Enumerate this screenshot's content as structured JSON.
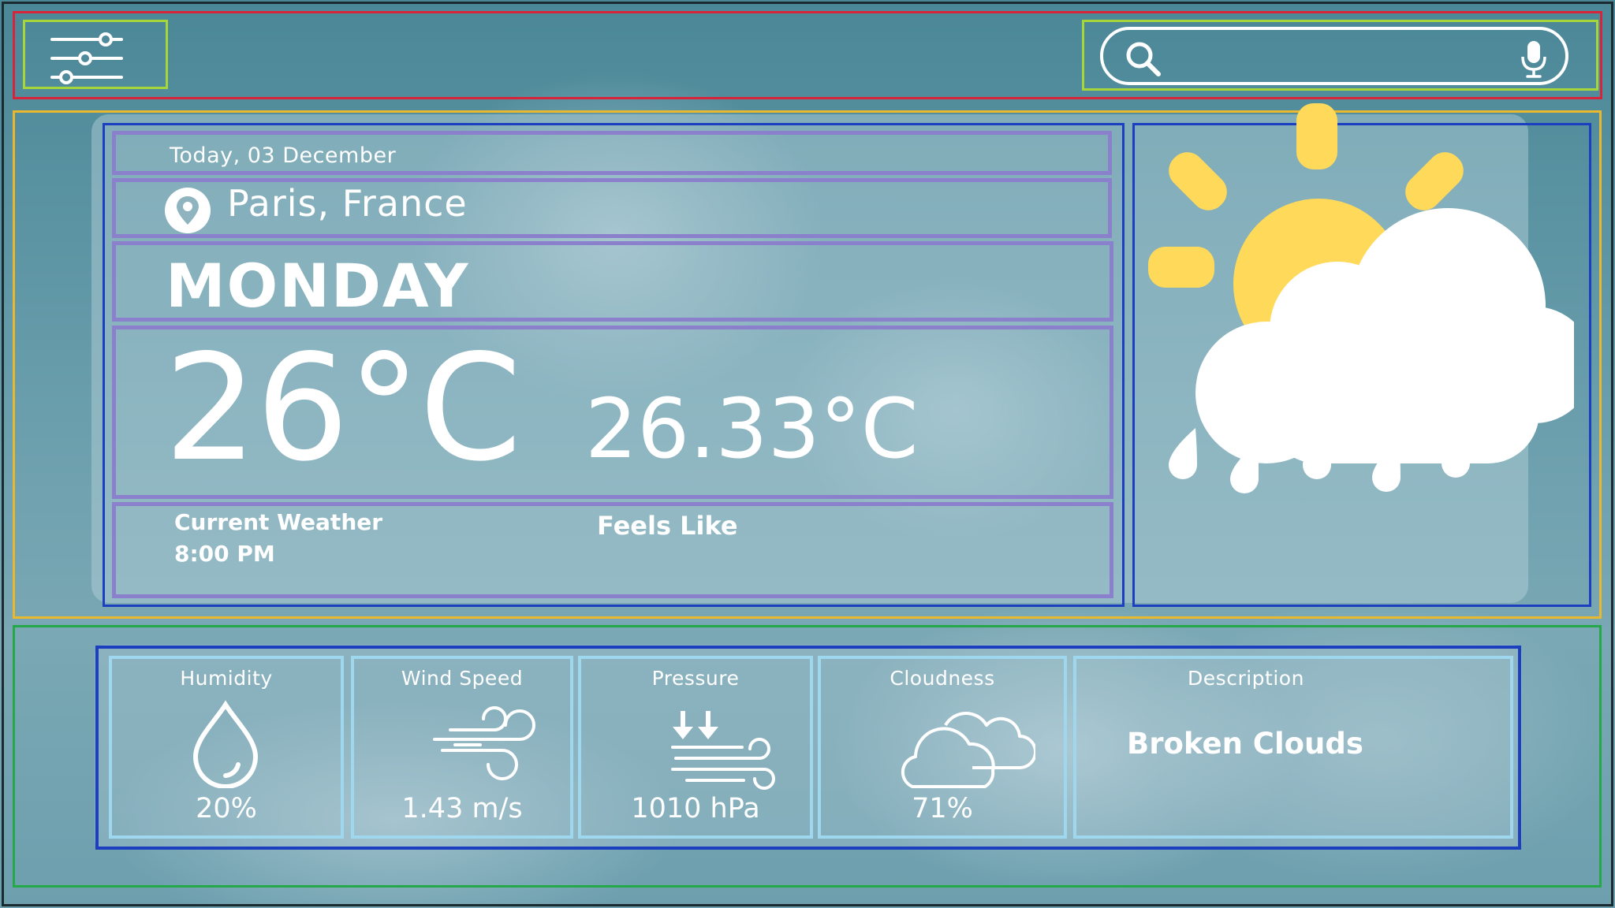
{
  "search": {
    "placeholder": ""
  },
  "current": {
    "date": "Today, 03 December",
    "location": "Paris, France",
    "day": "MONDAY",
    "temperature": "26°C",
    "feels_like_value": "26.33°C",
    "current_label": "Current Weather",
    "time": "8:00 PM",
    "feels_like_label": "Feels Like",
    "icon": "sun-cloud-rain-icon"
  },
  "stats": {
    "humidity": {
      "label": "Humidity",
      "value": "20%",
      "icon": "droplet-icon"
    },
    "wind": {
      "label": "Wind Speed",
      "value": "1.43 m/s",
      "icon": "wind-icon"
    },
    "pressure": {
      "label": "Pressure",
      "value": "1010 hPa",
      "icon": "pressure-icon"
    },
    "cloudiness": {
      "label": "Cloudness",
      "value": "71%",
      "icon": "clouds-icon"
    },
    "description": {
      "label": "Description",
      "value": "Broken Clouds"
    }
  },
  "colors": {
    "accent_sun": "#ffd95a",
    "text": "#ffffff",
    "annotation_red": "#d6243a",
    "annotation_green": "#a6d63a",
    "annotation_yellow": "#e8b92e",
    "annotation_blue": "#1c3fbf",
    "annotation_purple": "#8a80cc",
    "annotation_cyan": "#9fd8ee",
    "annotation_darkgreen": "#25a84a"
  }
}
